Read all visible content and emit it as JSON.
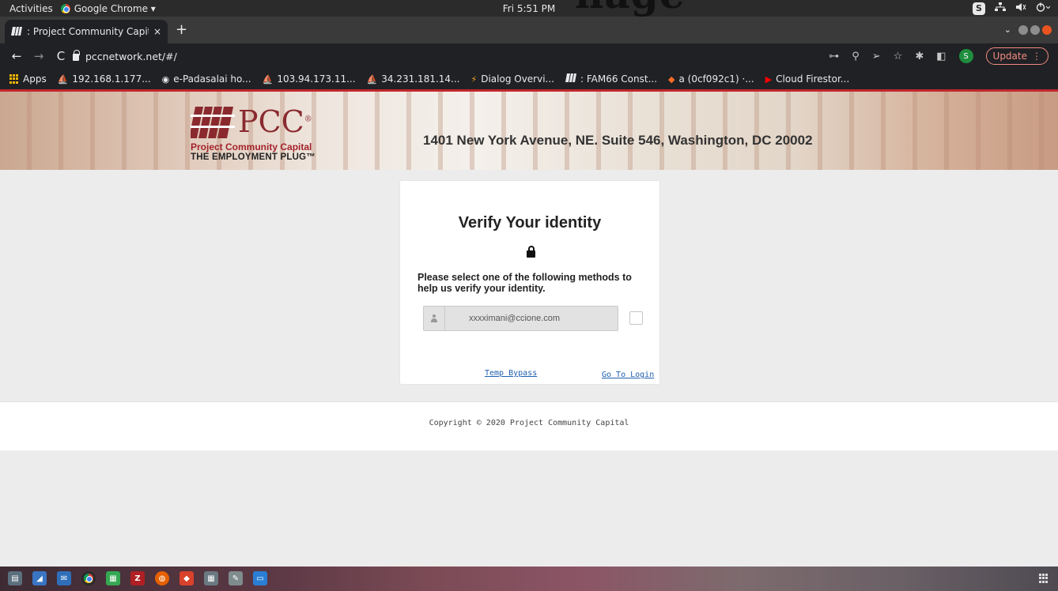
{
  "system": {
    "activities": "Activities",
    "app_menu": "Google Chrome ▾",
    "clock": "Fri  5:51 PM",
    "tray_badge": "S",
    "tray_icons": [
      "network-icon",
      "volume-icon",
      "power-icon"
    ]
  },
  "overlay": {
    "text": "nage"
  },
  "browser": {
    "tab": {
      "favicon": "pcc-favicon-icon",
      "title": ": Project Community Capit",
      "close": "×"
    },
    "new_tab": "+",
    "url": "pccnetwork.net/#/",
    "profile_initial": "S",
    "update_label": "Update",
    "bookmarks": [
      {
        "label": "Apps",
        "icon": "apps-grid-icon"
      },
      {
        "label": "192.168.1.177...",
        "icon": "pma-icon"
      },
      {
        "label": "e-Padasalai ho...",
        "icon": "globe-icon"
      },
      {
        "label": "103.94.173.11...",
        "icon": "pma-icon"
      },
      {
        "label": "34.231.181.14...",
        "icon": "pma-icon"
      },
      {
        "label": "Dialog Overvi...",
        "icon": "bolt-icon"
      },
      {
        "label": ": FAM66 Const...",
        "icon": "pcc-favicon-icon"
      },
      {
        "label": "a (0cf092c1) ·...",
        "icon": "gitlab-icon"
      },
      {
        "label": "Cloud Firestor...",
        "icon": "youtube-icon"
      }
    ]
  },
  "page": {
    "logo": {
      "mark": "PCC",
      "sup": "®",
      "name": "Project Community Capital",
      "tagline": "THE EMPLOYMENT PLUG™"
    },
    "address": "1401 New York Avenue, NE. Suite 546, Washington, DC 20002",
    "card": {
      "title": "Verify Your identity",
      "instructions": "Please select one of the following methods to help us verify your identity.",
      "email_value": "xxxximani@ccione.com",
      "bypass_link": "Temp Bypass",
      "login_link": "Go To Login"
    },
    "footer": "Copyright © 2020 Project Community Capital"
  },
  "colors": {
    "accent_red": "#c1272d",
    "logo_red": "#a3232a",
    "link_blue": "#1f5fae",
    "update_red": "#f28b82"
  }
}
